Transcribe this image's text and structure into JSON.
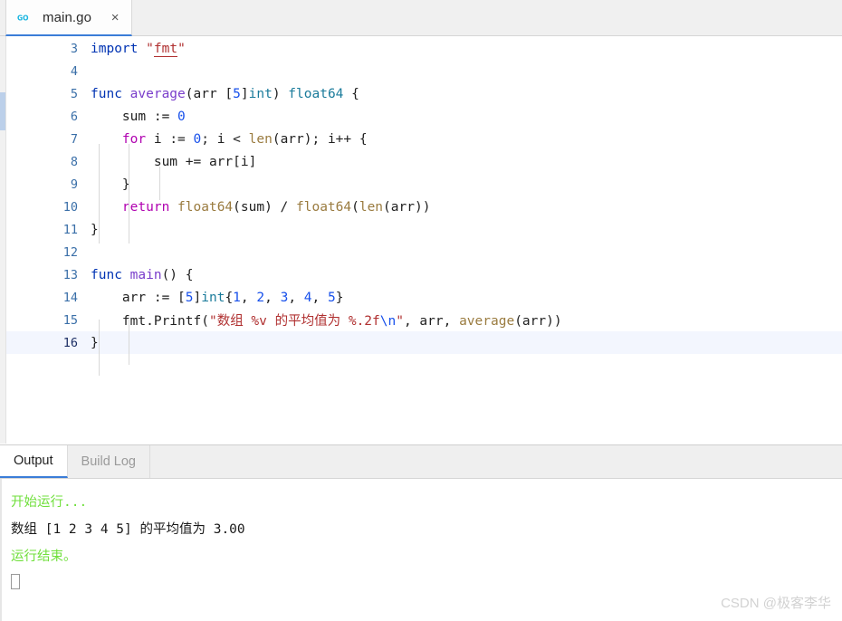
{
  "tab": {
    "icon": "go-file-icon",
    "label": "main.go",
    "close_label": "×",
    "active_accent": "#3b7dd8"
  },
  "editor": {
    "first_visible_line": 3,
    "current_line": 16,
    "current_line_bg": "#f3f6fe",
    "gutter_color": "#3a6fa8",
    "lines": [
      {
        "num": "3",
        "text": "import \"fmt\""
      },
      {
        "num": "4",
        "text": ""
      },
      {
        "num": "5",
        "text": "func average(arr [5]int) float64 {"
      },
      {
        "num": "6",
        "text": "    sum := 0"
      },
      {
        "num": "7",
        "text": "    for i := 0; i < len(arr); i++ {"
      },
      {
        "num": "8",
        "text": "        sum += arr[i]"
      },
      {
        "num": "9",
        "text": "    }"
      },
      {
        "num": "10",
        "text": "    return float64(sum) / float64(len(arr))"
      },
      {
        "num": "11",
        "text": "}"
      },
      {
        "num": "12",
        "text": ""
      },
      {
        "num": "13",
        "text": "func main() {"
      },
      {
        "num": "14",
        "text": "    arr := [5]int{1, 2, 3, 4, 5}"
      },
      {
        "num": "15",
        "text": "    fmt.Printf(\"数组 %v 的平均值为 %.2f\\n\", arr, average(arr))"
      },
      {
        "num": "16",
        "text": "}"
      }
    ],
    "syntax_colors": {
      "keyword": "#0033b3",
      "keyword_control": "#b000b0",
      "function_decl": "#7a3ecb",
      "type": "#1a7b9b",
      "number": "#1750eb",
      "string": "#b03030",
      "escape": "#1750eb",
      "call": "#9a7b3f",
      "plain": "#202020"
    }
  },
  "panel": {
    "tabs": [
      {
        "label": "Output",
        "active": true
      },
      {
        "label": "Build Log",
        "active": false
      }
    ],
    "output_lines": [
      {
        "text": "开始运行...",
        "color": "green"
      },
      {
        "text": "数组 [1 2 3 4 5] 的平均值为 3.00",
        "color": "black"
      },
      {
        "text": "运行结束。",
        "color": "green"
      }
    ],
    "colors": {
      "green": "#6fdf3b",
      "black": "#1a1a1a"
    }
  },
  "watermark": {
    "text": "CSDN @极客李华"
  }
}
